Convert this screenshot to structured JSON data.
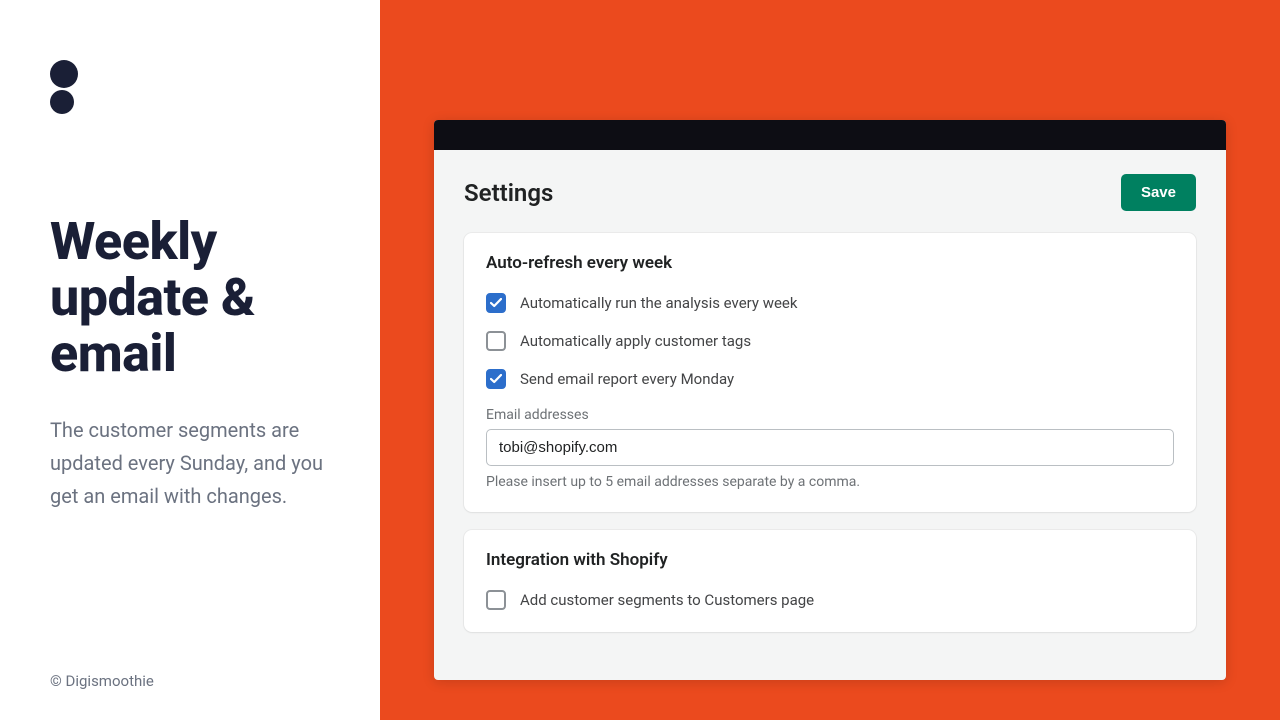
{
  "sidebar": {
    "headline": "Weekly update & email",
    "description": "The customer segments are updated every Sunday, and you get an email with changes.",
    "copyright": "© Digismoothie"
  },
  "settings": {
    "title": "Settings",
    "save_label": "Save",
    "sections": {
      "auto_refresh": {
        "title": "Auto-refresh every week",
        "opt_run_analysis": {
          "label": "Automatically run the analysis every week",
          "checked": true
        },
        "opt_apply_tags": {
          "label": "Automatically apply customer tags",
          "checked": false
        },
        "opt_email_report": {
          "label": "Send email report every Monday",
          "checked": true
        },
        "email_field": {
          "label": "Email addresses",
          "value": "tobi@shopify.com",
          "help": "Please insert up to 5 email addresses separate by a comma."
        }
      },
      "integration": {
        "title": "Integration with Shopify",
        "opt_add_segments": {
          "label": "Add customer segments to Customers page",
          "checked": false
        }
      }
    }
  }
}
